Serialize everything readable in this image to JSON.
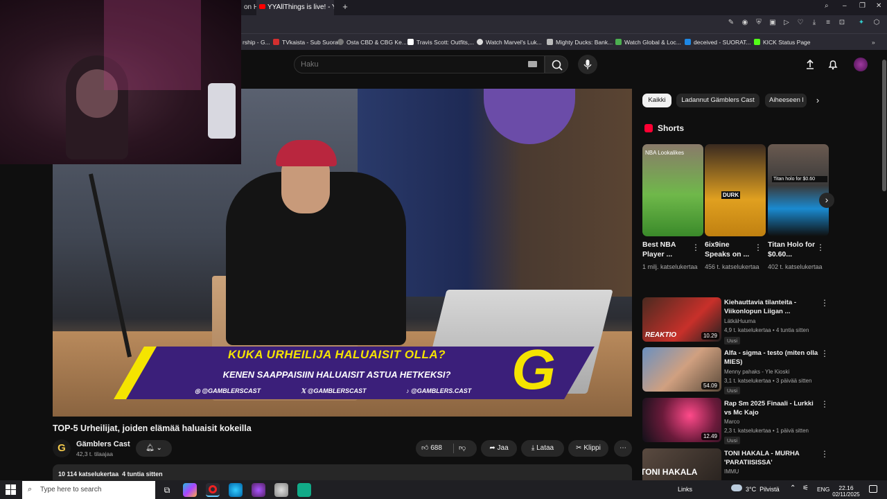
{
  "browser": {
    "tabs": [
      {
        "label": "on H"
      },
      {
        "label": "YYAllThings is live! - YouT"
      }
    ],
    "bookmarks": [
      {
        "label": "rship - G...",
        "color": "#3a3a3a"
      },
      {
        "label": "TVkaista - Sub Suora",
        "color": "#d32f2f"
      },
      {
        "label": "Osta CBD & CBG Ke...",
        "color": "#777"
      },
      {
        "label": "Travis Scott: Outfits,...",
        "color": "#ffffff"
      },
      {
        "label": "Watch Marvel's Luk...",
        "color": "#dddddd"
      },
      {
        "label": "Mighty Ducks: Bank...",
        "color": "#bbbbbb"
      },
      {
        "label": "Watch Global & Loc...",
        "color": "#4caf50"
      },
      {
        "label": "deceived - SUORAT...",
        "color": "#1e88e5"
      },
      {
        "label": "KICK Status Page",
        "color": "#53fc18"
      }
    ]
  },
  "header": {
    "search_placeholder": "Haku"
  },
  "video": {
    "banner_line1": "KUKA URHEILIJA HALUAISIT OLLA?",
    "banner_line2": "KENEN SAAPPAISIIN HALUAISIT ASTUA HETKEKSI?",
    "social1": "@GAMBLERSCAST",
    "social2": "@GAMBLERSCAST",
    "social3": "@GAMBLERS.CAST",
    "logo_letter": "G",
    "title": "TOP-5 Urheilijat, joiden elämää haluaisit kokeilla",
    "channel_name": "Gämblers Cast",
    "subscribers": "42,3 t. tilaajaa",
    "likes": "688",
    "share_label": "Jaa",
    "download_label": "Lataa",
    "clip_label": "Klippi",
    "description_meta": "10 114 katselukertaa  4 tuntia sitten"
  },
  "sidebar": {
    "chips": [
      "Kaikki",
      "Ladannut Gämblers Cast",
      "Aiheeseen l"
    ],
    "shorts_heading": "Shorts",
    "shorts": [
      {
        "title": "Best NBA Player ...",
        "views": "1 milj. katselukertaa",
        "overlay": "NBA Lookalikes"
      },
      {
        "title": "6ix9ine Speaks on ...",
        "views": "456 t. katselukertaa",
        "overlay": "DURK"
      },
      {
        "title": "Titan Holo for $0.60...",
        "views": "402 t. katselukertaa",
        "overlay": "Titan holo for $0.60"
      }
    ],
    "recommendations": [
      {
        "title": "Kiehauttavia tilanteita - Viikonlopun Liigan ...",
        "channel": "LätkäHuuma",
        "meta": "4,9 t. katselukertaa • 4 tuntia sitten",
        "duration": "10.29",
        "badge": "Uusi",
        "overlay": "REAKTIO"
      },
      {
        "title": "Alfa - sigma - testo (miten olla MIES)",
        "channel": "Menny pahaks - Yle Kioski",
        "meta": "3,1 t. katselukertaa • 3 päivää sitten",
        "duration": "54.09",
        "badge": "Uusi",
        "overlay": ""
      },
      {
        "title": "Rap Sm 2025 Finaali - Lurkki vs Mc Kajo",
        "channel": "Marco",
        "meta": "2,3 t. katselukertaa • 1 päivä sitten",
        "duration": "12.49",
        "badge": "Uusi",
        "overlay": ""
      },
      {
        "title": "TONI HAKALA - MURHA 'PARATIISISSA'",
        "channel": "IMMU",
        "meta": "",
        "duration": "",
        "badge": "",
        "overlay": "TONI HAKALA"
      }
    ]
  },
  "taskbar": {
    "search_placeholder": "Type here to search",
    "links_label": "Links",
    "weather": "3°C  Pilvistä",
    "language": "ENG",
    "time": "22.16",
    "date": "02/11/2025"
  }
}
